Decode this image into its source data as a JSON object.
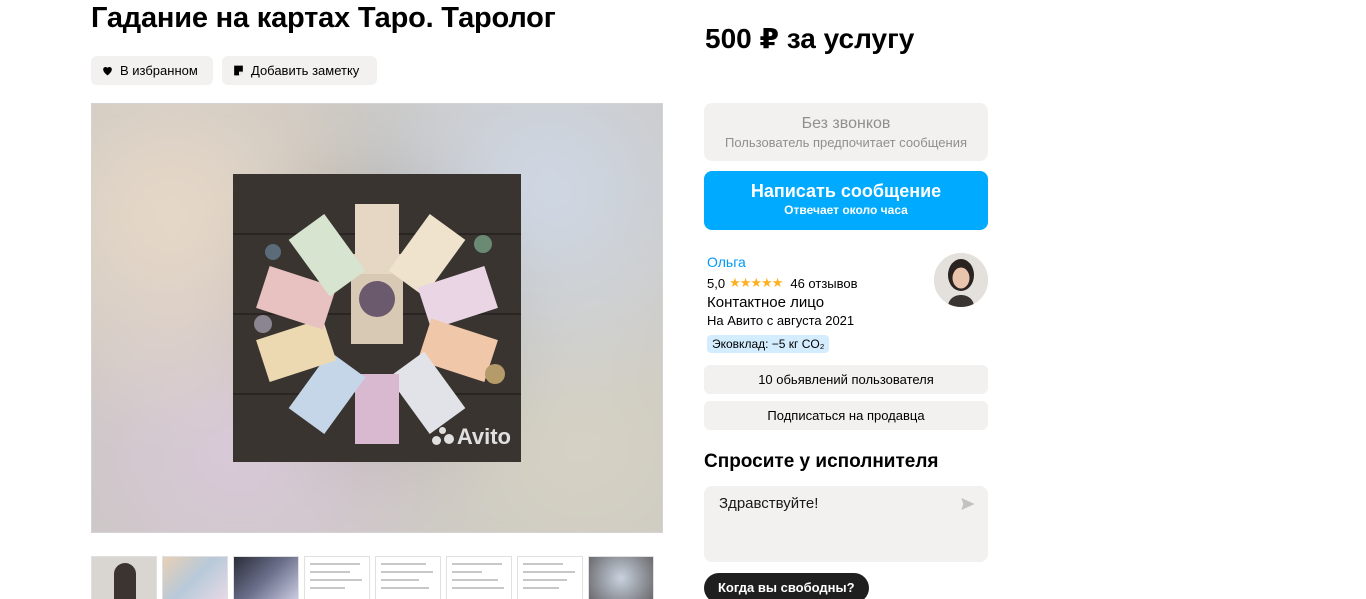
{
  "listing": {
    "title": "Гадание на картах Таро. Таролог",
    "favorite_label": "В избранном",
    "note_label": "Добавить заметку",
    "watermark": "Avito"
  },
  "price": {
    "text": "500 ₽ за услугу"
  },
  "contact": {
    "no_calls_title": "Без звонков",
    "no_calls_subtitle": "Пользователь предпочитает сообщения",
    "write_label": "Написать сообщение",
    "write_subtitle": "Отвечает около часа"
  },
  "seller": {
    "name": "Ольга",
    "rating": "5,0",
    "stars": "★★★★★",
    "reviews": "46 отзывов",
    "role": "Контактное лицо",
    "since": "На Авито с августа 2021",
    "eco": "Эковклад: −5 кг CO₂",
    "ads_button": "10 обьявлений пользователя",
    "subscribe_button": "Подписаться на продавца"
  },
  "ask": {
    "title": "Спросите у исполнителя",
    "message_value": "Здравствуйте!",
    "quick_reply": "Когда вы свободны?"
  },
  "colors": {
    "accent": "#00aaff",
    "link": "#0099f7",
    "star": "#ffb021",
    "chip_bg": "#f2f1f0",
    "eco_bg": "#d3edff"
  },
  "icons": {
    "favorite": "heart-icon",
    "note": "note-icon",
    "send": "send-icon"
  }
}
